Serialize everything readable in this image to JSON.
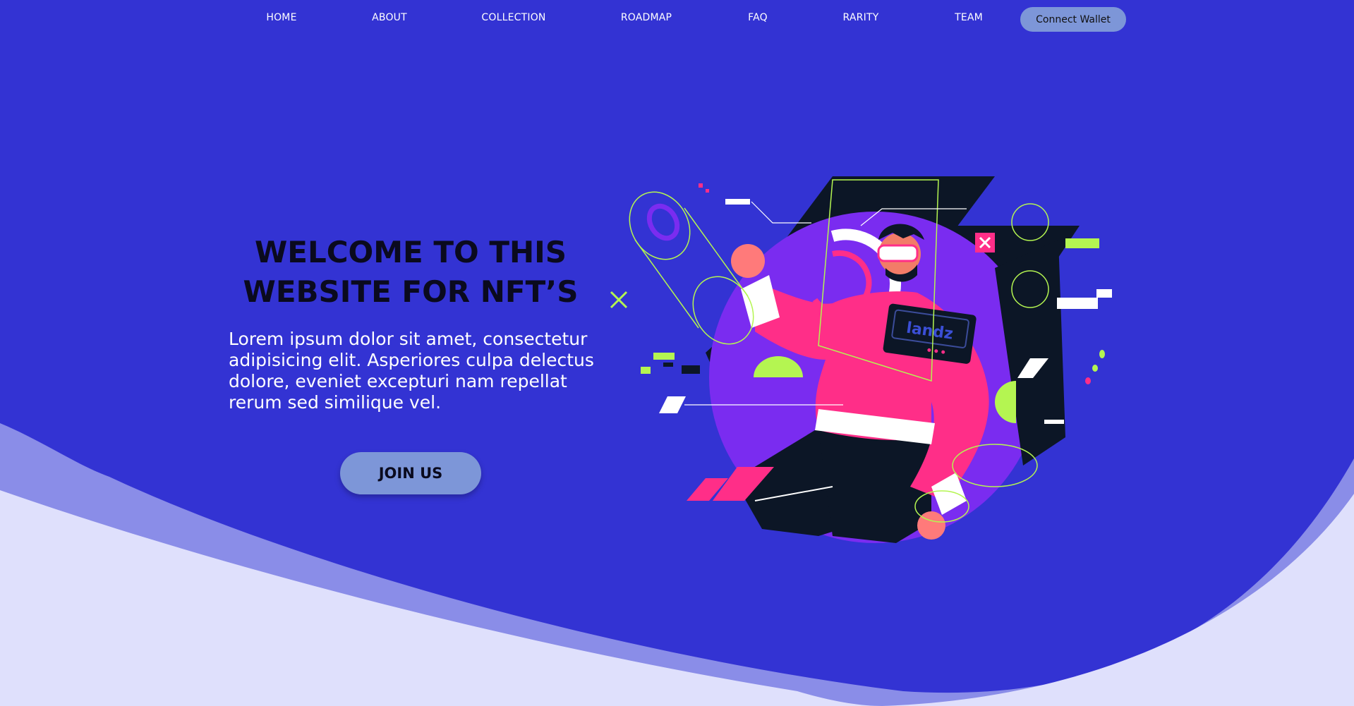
{
  "nav": {
    "items": [
      {
        "label": "HOME"
      },
      {
        "label": "ABOUT"
      },
      {
        "label": "COLLECTION"
      },
      {
        "label": "ROADMAP"
      },
      {
        "label": "FAQ"
      },
      {
        "label": "RARITY"
      },
      {
        "label": "TEAM"
      }
    ],
    "connect_label": "Connect Wallet"
  },
  "hero": {
    "title_line1": "WELCOME TO THIS",
    "title_line2": "WEBSITE FOR NFT’S",
    "description": "Lorem ipsum dolor sit amet, consectetur adipisicing elit. Asperiores culpa delectus dolore, eveniet excepturi nam repellat rerum sed similique vel.",
    "join_label": "JOIN US",
    "illustration_badge": "landz"
  },
  "colors": {
    "background": "#3333d3",
    "button": "#7d96d8",
    "wave_mid": "#8a8de8",
    "wave_light": "#dfe0fc",
    "accent_pink": "#ff2e88",
    "accent_green": "#b4f551",
    "accent_purple": "#7a2cf0",
    "dark": "#0c1626"
  }
}
